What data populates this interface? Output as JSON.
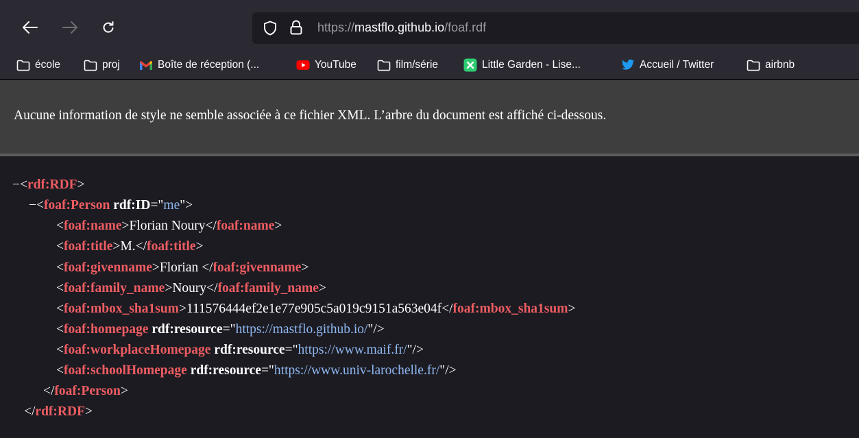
{
  "browser": {
    "url_scheme": "https://",
    "url_host": "mastflo.github.io",
    "url_path": "/foaf.rdf"
  },
  "bookmarks": [
    {
      "label": "école",
      "icon": "folder-icon"
    },
    {
      "label": "proj",
      "icon": "folder-icon"
    },
    {
      "label": "Boîte de réception (...",
      "icon": "gmail-icon"
    },
    {
      "label": "YouTube",
      "icon": "youtube-icon"
    },
    {
      "label": "film/série",
      "icon": "folder-icon"
    },
    {
      "label": "Little Garden - Lise...",
      "icon": "little-garden-icon"
    },
    {
      "label": "Accueil / Twitter",
      "icon": "twitter-icon"
    },
    {
      "label": "airbnb",
      "icon": "folder-icon"
    }
  ],
  "info_banner": {
    "text": "Aucune information de style ne semble associée à ce fichier XML. L’arbre du document est affiché ci-dessous."
  },
  "xml": {
    "collapse_symbol": "−",
    "root_tag": "rdf:RDF",
    "person_tag": "foaf:Person",
    "person_attr": "rdf:ID",
    "person_attr_value": "me",
    "name_tag": "foaf:name",
    "name_value": "Florian Noury",
    "title_tag": "foaf:title",
    "title_value": "M.",
    "givenname_tag": "foaf:givenname",
    "givenname_value": "Florian ",
    "family_name_tag": "foaf:family_name",
    "family_name_value": "Noury",
    "mbox_tag": "foaf:mbox_sha1sum",
    "mbox_value": "111576444ef2e1e77e905c5a019c9151a563e04f",
    "homepage_tag": "foaf:homepage",
    "workplace_tag": "foaf:workplaceHomepage",
    "school_tag": "foaf:schoolHomepage",
    "resource_attr": "rdf:resource",
    "homepage_value": "https://mastflo.github.io/",
    "workplace_value": "https://www.maif.fr/",
    "school_value": "https://www.univ-larochelle.fr/"
  },
  "colors": {
    "tag": "#ee5d62",
    "attr_value": "#8fb8f0",
    "background": "#1c1b22",
    "banner": "#3e3e3e"
  }
}
